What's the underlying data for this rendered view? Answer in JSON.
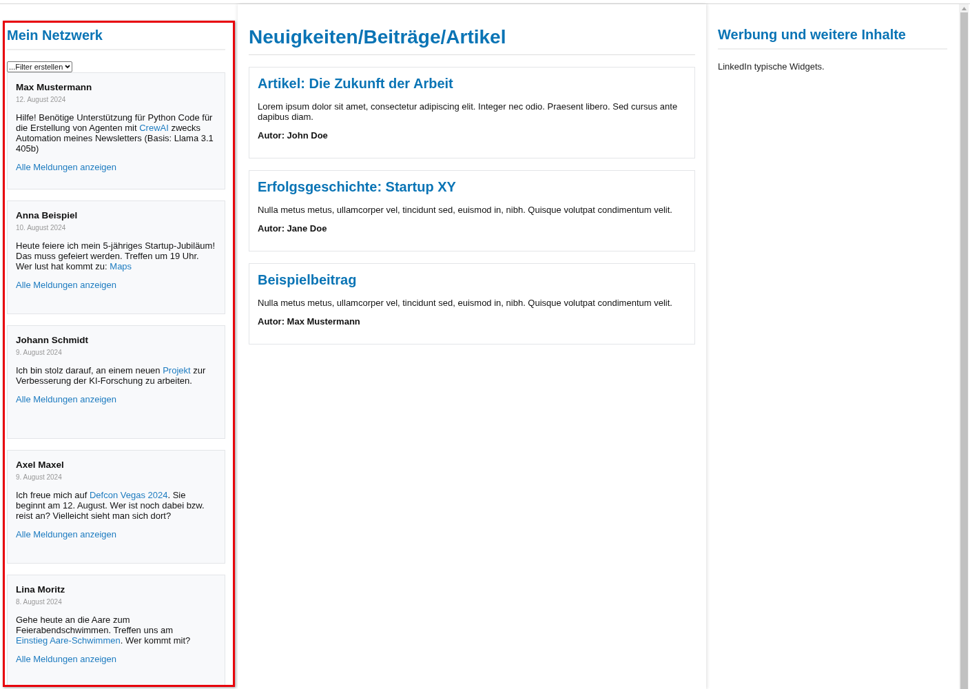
{
  "network": {
    "title": "Mein Netzwerk",
    "filter": {
      "value": "...Filter erstellen"
    },
    "posts": [
      {
        "author": "Max Mustermann",
        "date": "12. August 2024",
        "body": [
          {
            "kind": "text",
            "text": "Hilfe! Benötige Unterstützung für Python Code für die Erstellung von Agenten mit "
          },
          {
            "kind": "link",
            "text": "CrewAI"
          },
          {
            "kind": "text",
            "text": " zwecks Automation meines Newsletters (Basis: Llama 3.1 405b)"
          }
        ],
        "more_link": "Alle Meldungen anzeigen"
      },
      {
        "author": "Anna Beispiel",
        "date": "10. August 2024",
        "body": [
          {
            "kind": "text",
            "text": "Heute feiere ich mein 5-jähriges Startup-Jubiläum! Das muss gefeiert werden. Treffen um 19 Uhr. Wer lust hat kommt zu: "
          },
          {
            "kind": "link",
            "text": "Maps"
          }
        ],
        "more_link": "Alle Meldungen anzeigen"
      },
      {
        "author": "Johann Schmidt",
        "date": "9. August 2024",
        "body": [
          {
            "kind": "text",
            "text": "Ich bin stolz darauf, an einem neuen "
          },
          {
            "kind": "link",
            "text": "Projekt"
          },
          {
            "kind": "text",
            "text": " zur Verbesserung der KI-Forschung zu arbeiten."
          }
        ],
        "more_link": "Alle Meldungen anzeigen"
      },
      {
        "author": "Axel Maxel",
        "date": "9. August 2024",
        "body": [
          {
            "kind": "text",
            "text": "Ich freue mich auf "
          },
          {
            "kind": "link",
            "text": "Defcon Vegas 2024"
          },
          {
            "kind": "text",
            "text": ". Sie beginnt am 12. August. Wer ist noch dabei bzw. reist an? Vielleicht sieht man sich dort?"
          }
        ],
        "more_link": "Alle Meldungen anzeigen"
      },
      {
        "author": "Lina Moritz",
        "date": "8. August 2024",
        "body": [
          {
            "kind": "text",
            "text": "Gehe heute an die Aare zum Feierabendschwimmen. Treffen uns am "
          },
          {
            "kind": "link",
            "text": "Einstieg Aare-Schwimmen"
          },
          {
            "kind": "text",
            "text": ". Wer kommt mit?"
          }
        ],
        "more_link": "Alle Meldungen anzeigen"
      }
    ]
  },
  "news": {
    "title": "Neuigkeiten/Beiträge/Artikel",
    "articles": [
      {
        "title": "Artikel: Die Zukunft der Arbeit",
        "text": "Lorem ipsum dolor sit amet, consectetur adipiscing elit. Integer nec odio. Praesent libero. Sed cursus ante dapibus diam.",
        "author": "Autor: John Doe"
      },
      {
        "title": "Erfolgsgeschichte: Startup XY",
        "text": "Nulla metus metus, ullamcorper vel, tincidunt sed, euismod in, nibh. Quisque volutpat condimentum velit.",
        "author": "Autor: Jane Doe"
      },
      {
        "title": "Beispielbeitrag",
        "text": "Nulla metus metus, ullamcorper vel, tincidunt sed, euismod in, nibh. Quisque volutpat condimentum velit.",
        "author": "Autor: Max Mustermann"
      }
    ]
  },
  "ads": {
    "title": "Werbung und weitere Inhalte",
    "text": "LinkedIn typische Widgets."
  }
}
